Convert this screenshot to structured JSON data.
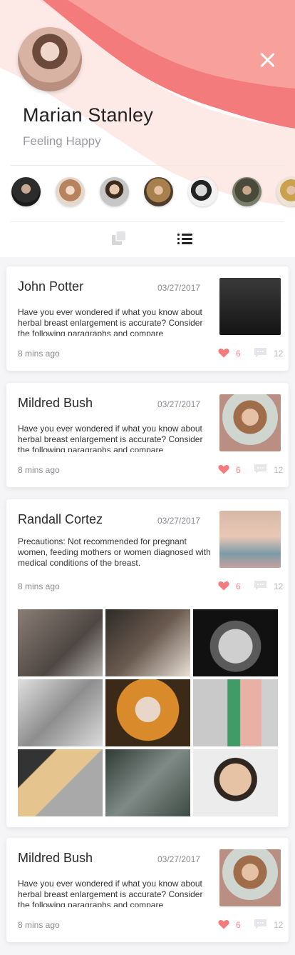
{
  "colors": {
    "accent_pink": "#f47b7b",
    "wave_light": "#fde3e1",
    "like_heart": "#f47b7b",
    "muted_text": "#8a8a92"
  },
  "profile": {
    "name": "Marian Stanley",
    "status": "Feeling Happy",
    "close_icon": "close-icon"
  },
  "stories": [
    "avatar-1",
    "avatar-2",
    "avatar-3",
    "avatar-4",
    "avatar-5",
    "avatar-6",
    "avatar-7"
  ],
  "view_toggle": {
    "grid_icon": "grid-view-icon",
    "list_icon": "list-view-icon",
    "active": "list"
  },
  "posts": [
    {
      "author": "John Potter",
      "date": "03/27/2017",
      "text": "Have you ever wondered if what you know about herbal breast enlargement is accurate? Consider the following paragraphs and compare",
      "time": "8 mins ago",
      "likes": "6",
      "comments": "12"
    },
    {
      "author": "Mildred Bush",
      "date": "03/27/2017",
      "text": "Have you ever wondered if what you know about herbal breast enlargement is accurate? Consider the following paragraphs and compare",
      "time": "8 mins ago",
      "likes": "6",
      "comments": "12"
    },
    {
      "author": "Randall Cortez",
      "date": "03/27/2017",
      "text": "Precautions: Not recommended for pregnant women, feeding mothers or women diagnosed with medical conditions of the breast.",
      "time": "8 mins ago",
      "likes": "6",
      "comments": "12",
      "gallery_count": 9
    },
    {
      "author": "Mildred Bush",
      "date": "03/27/2017",
      "text": "Have you ever wondered if what you know about herbal breast enlargement is accurate? Consider the following paragraphs and compare",
      "time": "8 mins ago",
      "likes": "6",
      "comments": "12"
    }
  ]
}
